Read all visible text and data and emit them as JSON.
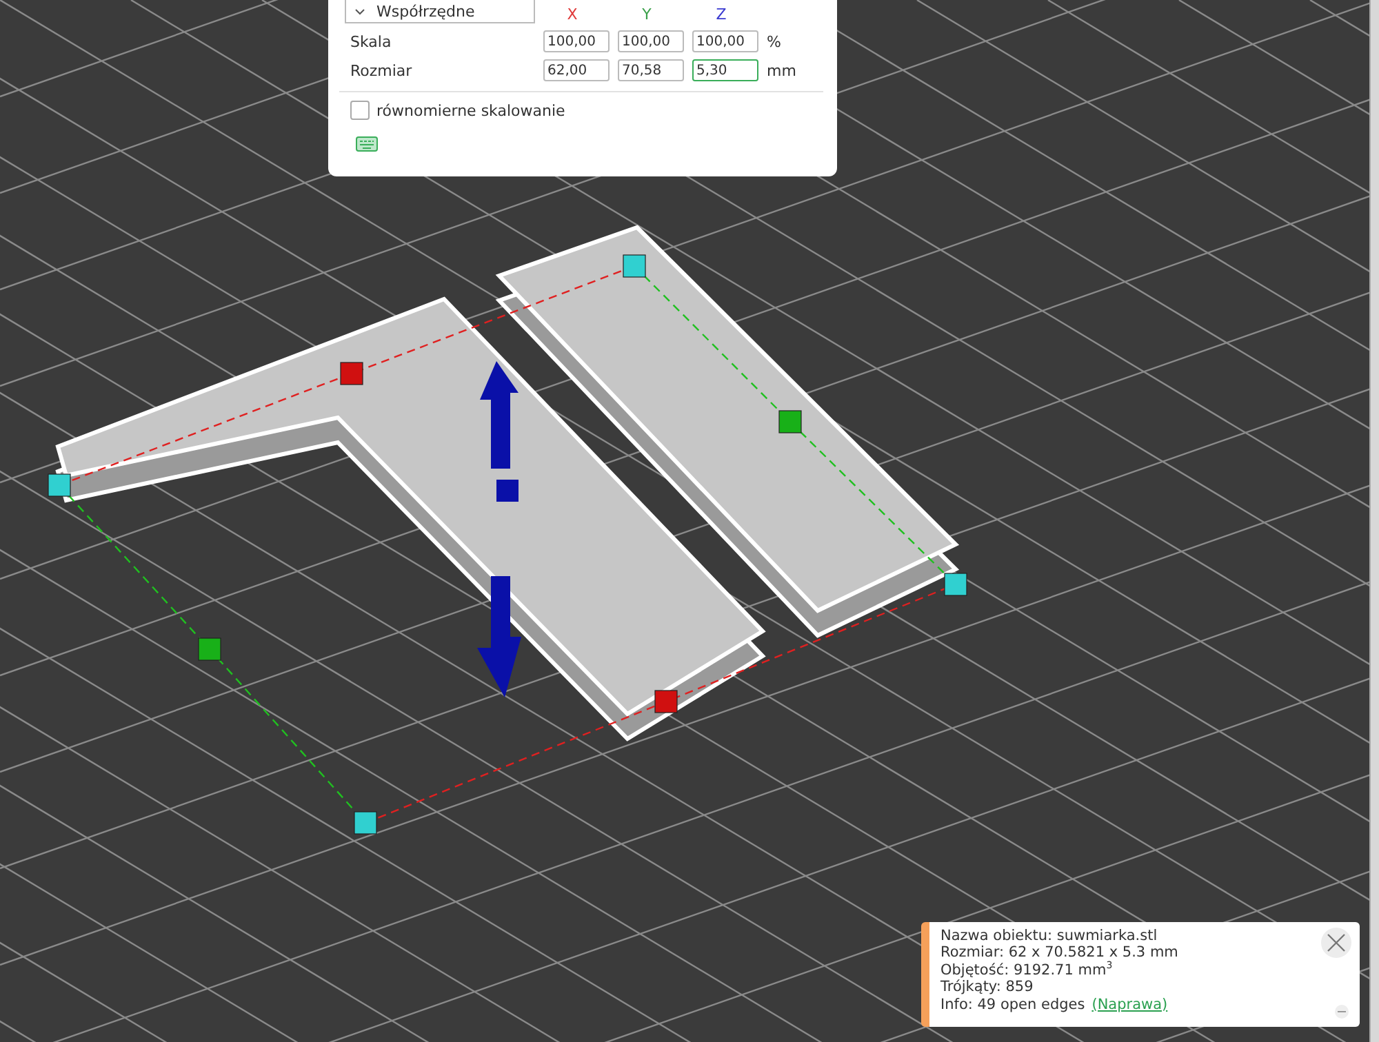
{
  "transform_panel": {
    "coordinate_system": "Współrzędne",
    "axes": [
      {
        "label": "X",
        "color": "#e03a3a"
      },
      {
        "label": "Y",
        "color": "#3aa04a"
      },
      {
        "label": "Z",
        "color": "#3a3ad0"
      }
    ],
    "rows": [
      {
        "label": "Skala",
        "values": [
          {
            "value": "100,00",
            "focused": false
          },
          {
            "value": "100,00",
            "focused": false
          },
          {
            "value": "100,00",
            "focused": false
          }
        ],
        "unit": "%"
      },
      {
        "label": "Rozmiar",
        "values": [
          {
            "value": "62,00",
            "focused": false
          },
          {
            "value": "70,58",
            "focused": false
          },
          {
            "value": "5,30",
            "focused": true
          }
        ],
        "unit": "mm"
      }
    ],
    "uniform_scaling": {
      "label": "równomierne skalowanie",
      "checked": false
    }
  },
  "info_notification": {
    "lines": [
      "Nazwa obiektu: suwmiarka.stl",
      "Rozmiar: 62 x 70.5821 x 5.3 mm",
      "Objętość: 9192.71 mm$^{3}$",
      "Trójkąty: 859",
      "Info: 49 open edges"
    ],
    "link": "(Naprawa)"
  }
}
